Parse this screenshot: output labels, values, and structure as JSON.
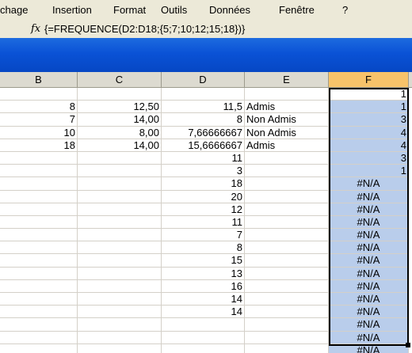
{
  "menu": {
    "items": [
      "chage",
      "Insertion",
      "Format",
      "Outils",
      "Données",
      "Fenêtre",
      "?"
    ]
  },
  "formula_bar": {
    "fx": "fx",
    "formula": "{=FREQUENCE(D2:D18;{5;7;10;12;15;18})}"
  },
  "columns": [
    "B",
    "C",
    "D",
    "E",
    "F"
  ],
  "rows": [
    {
      "B": "",
      "C": "",
      "D": "",
      "E": "",
      "F": "1"
    },
    {
      "B": "8",
      "C": "12,50",
      "D": "11,5",
      "E": "Admis",
      "F": "1"
    },
    {
      "B": "7",
      "C": "14,00",
      "D": "8",
      "E": "Non Admis",
      "F": "3"
    },
    {
      "B": "10",
      "C": "8,00",
      "D": "7,66666667",
      "E": "Non Admis",
      "F": "4"
    },
    {
      "B": "18",
      "C": "14,00",
      "D": "15,6666667",
      "E": "Admis",
      "F": "4"
    },
    {
      "B": "",
      "C": "",
      "D": "11",
      "E": "",
      "F": "3"
    },
    {
      "B": "",
      "C": "",
      "D": "3",
      "E": "",
      "F": "1"
    },
    {
      "B": "",
      "C": "",
      "D": "18",
      "E": "",
      "F": "#N/A"
    },
    {
      "B": "",
      "C": "",
      "D": "20",
      "E": "",
      "F": "#N/A"
    },
    {
      "B": "",
      "C": "",
      "D": "12",
      "E": "",
      "F": "#N/A"
    },
    {
      "B": "",
      "C": "",
      "D": "11",
      "E": "",
      "F": "#N/A"
    },
    {
      "B": "",
      "C": "",
      "D": "7",
      "E": "",
      "F": "#N/A"
    },
    {
      "B": "",
      "C": "",
      "D": "8",
      "E": "",
      "F": "#N/A"
    },
    {
      "B": "",
      "C": "",
      "D": "15",
      "E": "",
      "F": "#N/A"
    },
    {
      "B": "",
      "C": "",
      "D": "13",
      "E": "",
      "F": "#N/A"
    },
    {
      "B": "",
      "C": "",
      "D": "16",
      "E": "",
      "F": "#N/A"
    },
    {
      "B": "",
      "C": "",
      "D": "14",
      "E": "",
      "F": "#N/A"
    },
    {
      "B": "",
      "C": "",
      "D": "14",
      "E": "",
      "F": "#N/A"
    },
    {
      "B": "",
      "C": "",
      "D": "",
      "E": "",
      "F": "#N/A"
    },
    {
      "B": "",
      "C": "",
      "D": "",
      "E": "",
      "F": "#N/A"
    },
    {
      "B": "",
      "C": "",
      "D": "",
      "E": "",
      "F": "#N/A"
    },
    {
      "B": "",
      "C": "",
      "D": "",
      "E": "",
      "F": ""
    }
  ],
  "colors": {
    "selection": "#b9cdeb",
    "titlebar": "#0a52d6",
    "chrome": "#ece9d8"
  }
}
